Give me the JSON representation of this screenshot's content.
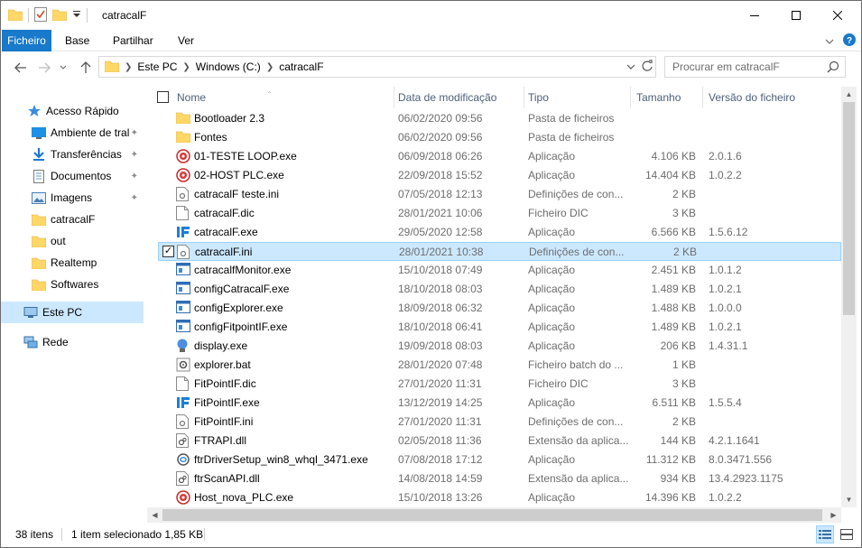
{
  "window": {
    "title": "catracalF",
    "colors": {
      "accent": "#1979ca",
      "selection": "#cce8ff",
      "folder": "#ffd766"
    }
  },
  "ribbon": {
    "tabs": [
      {
        "label": "Ficheiro"
      },
      {
        "label": "Base"
      },
      {
        "label": "Partilhar"
      },
      {
        "label": "Ver"
      }
    ]
  },
  "address": {
    "crumbs": [
      "Este PC",
      "Windows (C:)",
      "catracalF"
    ]
  },
  "search": {
    "placeholder": "Procurar em catracalF"
  },
  "nav": {
    "quick_access": "Acesso Rápido",
    "items": [
      {
        "label": "Ambiente de tral",
        "icon": "desktop-icon"
      },
      {
        "label": "Transferências",
        "icon": "download-icon"
      },
      {
        "label": "Documentos",
        "icon": "document-icon"
      },
      {
        "label": "Imagens",
        "icon": "pictures-icon"
      },
      {
        "label": "catracalF",
        "icon": "folder-icon"
      },
      {
        "label": "out",
        "icon": "folder-icon"
      },
      {
        "label": "Realtemp",
        "icon": "folder-icon"
      },
      {
        "label": "Softwares",
        "icon": "folder-icon"
      }
    ],
    "this_pc": "Este PC",
    "network": "Rede"
  },
  "columns": {
    "name": "Nome",
    "date": "Data de modificação",
    "type": "Tipo",
    "size": "Tamanho",
    "version": "Versão do ficheiro"
  },
  "files": [
    {
      "name": "Bootloader 2.3",
      "date": "06/02/2020 09:56",
      "type": "Pasta de ficheiros",
      "size": "",
      "version": "",
      "icon": "folder-icon"
    },
    {
      "name": "Fontes",
      "date": "06/02/2020 09:56",
      "type": "Pasta de ficheiros",
      "size": "",
      "version": "",
      "icon": "folder-icon"
    },
    {
      "name": "01-TESTE LOOP.exe",
      "date": "06/09/2018 06:26",
      "type": "Aplicação",
      "size": "4.106 KB",
      "version": "2.0.1.6",
      "icon": "red-app-icon"
    },
    {
      "name": "02-HOST PLC.exe",
      "date": "22/09/2018 15:52",
      "type": "Aplicação",
      "size": "14.404 KB",
      "version": "1.0.2.2",
      "icon": "red-app-icon"
    },
    {
      "name": "catracalF teste.ini",
      "date": "07/05/2018 12:13",
      "type": "Definições de con...",
      "size": "2 KB",
      "version": "",
      "icon": "settings-file-icon"
    },
    {
      "name": "catracalF.dic",
      "date": "28/01/2021 10:06",
      "type": "Ficheiro DIC",
      "size": "3 KB",
      "version": "",
      "icon": "blank-file-icon"
    },
    {
      "name": "catracalF.exe",
      "date": "29/05/2020 12:58",
      "type": "Aplicação",
      "size": "6.566 KB",
      "version": "1.5.6.12",
      "icon": "if-app-icon"
    },
    {
      "name": "catracalF.ini",
      "date": "28/01/2021 10:38",
      "type": "Definições de con...",
      "size": "2 KB",
      "version": "",
      "icon": "settings-file-icon"
    },
    {
      "name": "catracalfMonitor.exe",
      "date": "15/10/2018 07:49",
      "type": "Aplicação",
      "size": "2.451 KB",
      "version": "1.0.1.2",
      "icon": "window-app-icon"
    },
    {
      "name": "configCatracalF.exe",
      "date": "18/10/2018 08:03",
      "type": "Aplicação",
      "size": "1.489 KB",
      "version": "1.0.2.1",
      "icon": "window-app-icon"
    },
    {
      "name": "configExplorer.exe",
      "date": "18/09/2018 06:32",
      "type": "Aplicação",
      "size": "1.488 KB",
      "version": "1.0.0.0",
      "icon": "window-app-icon"
    },
    {
      "name": "configFitpointIF.exe",
      "date": "18/10/2018 06:41",
      "type": "Aplicação",
      "size": "1.489 KB",
      "version": "1.0.2.1",
      "icon": "window-app-icon"
    },
    {
      "name": "display.exe",
      "date": "19/09/2018 08:03",
      "type": "Aplicação",
      "size": "206 KB",
      "version": "1.4.31.1",
      "icon": "display-app-icon"
    },
    {
      "name": "explorer.bat",
      "date": "28/01/2020 07:48",
      "type": "Ficheiro batch do ...",
      "size": "1 KB",
      "version": "",
      "icon": "gear-file-icon"
    },
    {
      "name": "FitPointIF.dic",
      "date": "27/01/2020 11:31",
      "type": "Ficheiro DIC",
      "size": "3 KB",
      "version": "",
      "icon": "blank-file-icon"
    },
    {
      "name": "FitPointIF.exe",
      "date": "13/12/2019 14:25",
      "type": "Aplicação",
      "size": "6.511 KB",
      "version": "1.5.5.4",
      "icon": "if-app-icon"
    },
    {
      "name": "FitPointIF.ini",
      "date": "27/01/2020 11:31",
      "type": "Definições de con...",
      "size": "2 KB",
      "version": "",
      "icon": "settings-file-icon"
    },
    {
      "name": "FTRAPI.dll",
      "date": "02/05/2018 11:36",
      "type": "Extensão da aplica...",
      "size": "144 KB",
      "version": "4.2.1.1641",
      "icon": "dll-file-icon"
    },
    {
      "name": "ftrDriverSetup_win8_whql_3471.exe",
      "date": "07/08/2018 17:12",
      "type": "Aplicação",
      "size": "11.312 KB",
      "version": "8.0.3471.556",
      "icon": "setup-app-icon"
    },
    {
      "name": "ftrScanAPI.dll",
      "date": "14/08/2018 14:59",
      "type": "Extensão da aplica...",
      "size": "934 KB",
      "version": "13.4.2923.1175",
      "icon": "dll-file-icon"
    },
    {
      "name": "Host_nova_PLC.exe",
      "date": "15/10/2018 13:26",
      "type": "Aplicação",
      "size": "14.396 KB",
      "version": "1.0.2.2",
      "icon": "red-app-icon"
    }
  ],
  "selected_index": 7,
  "status": {
    "count": "38 itens",
    "selection": "1 item selecionado 1,85 KB"
  }
}
